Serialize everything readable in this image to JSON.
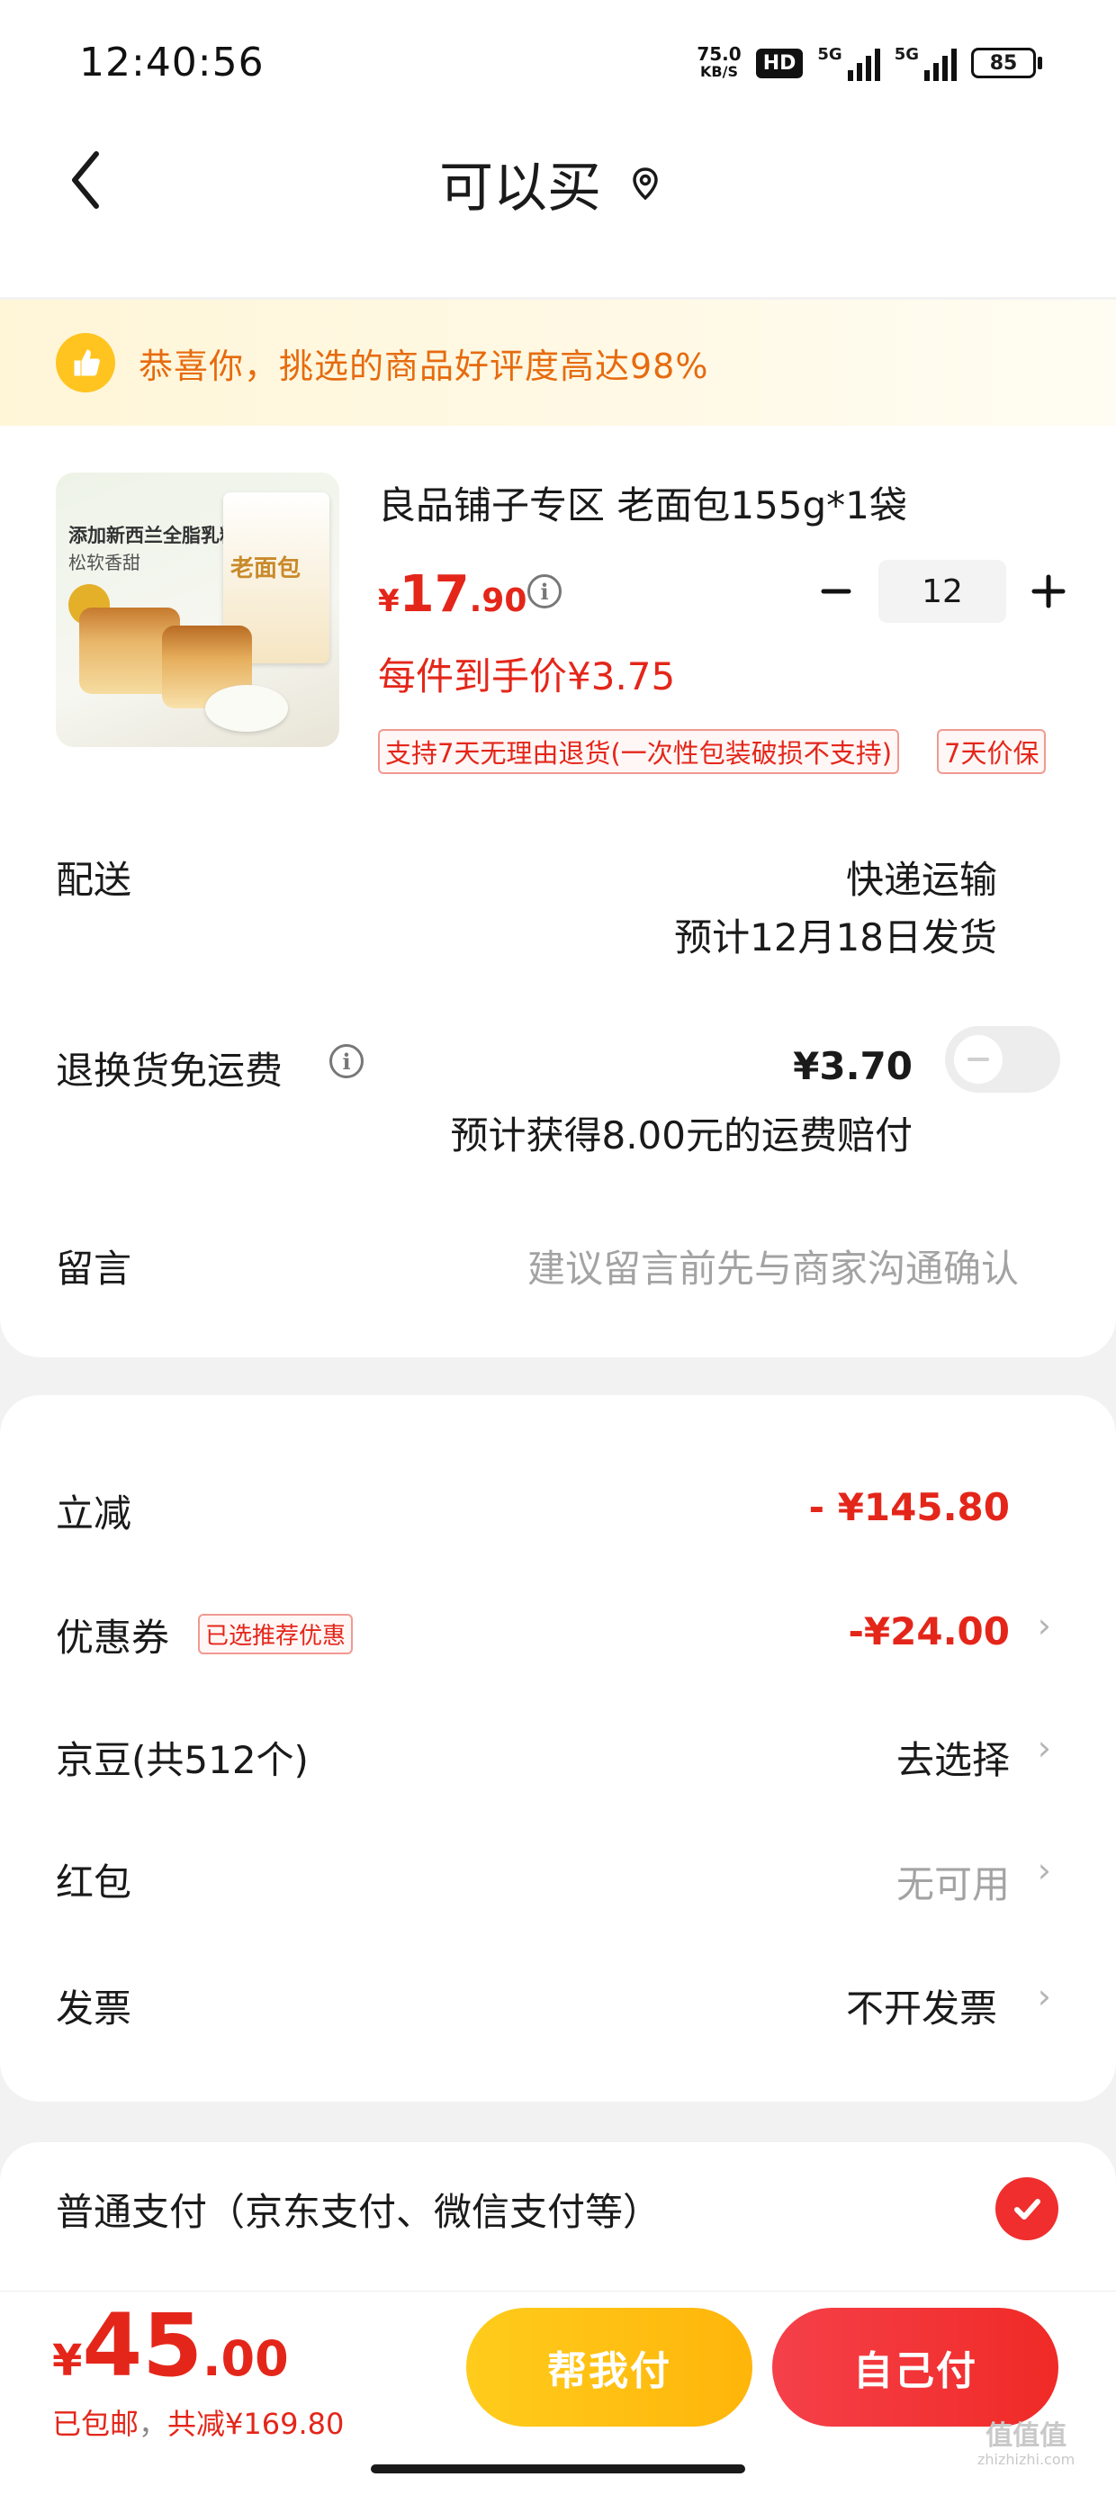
{
  "status_bar": {
    "time": "12:40:56",
    "net_speed_value": "75.0",
    "net_speed_unit": "KB/S",
    "hd_badge": "HD",
    "signal1_label": "5G",
    "signal2_label": "5G",
    "battery": "85"
  },
  "header": {
    "title": "可以买",
    "back_icon": "chevron-left-icon",
    "location_icon": "location-pin-icon"
  },
  "banner": {
    "icon": "thumbs-up-icon",
    "text": "恭喜你，挑选的商品好评度高达98%"
  },
  "product": {
    "name": "良品铺子专区 老面包155g*1袋",
    "image_text": "添加新西兰全脂乳粉",
    "image_subtext": "松软香甜",
    "image_pack_text": "老面包",
    "price_currency": "¥",
    "price_int": "17",
    "price_dec": ".90",
    "quantity": "12",
    "unit_price": "每件到手价¥3.75",
    "tags": [
      "支持7天无理由退货(一次性包装破损不支持)",
      "7天价保"
    ]
  },
  "delivery": {
    "label": "配送",
    "method": "快递运输",
    "eta": "预计12月18日发货"
  },
  "return_shipping": {
    "label": "退换货免运费",
    "price": "¥3.70",
    "compensation": "预计获得8.00元的运费赔付",
    "enabled": false
  },
  "message": {
    "label": "留言",
    "placeholder": "建议留言前先与商家沟通确认"
  },
  "discounts": {
    "instant_label": "立减",
    "instant_value": "- ¥145.80",
    "coupon_label": "优惠券",
    "coupon_badge": "已选推荐优惠",
    "coupon_value": "-¥24.00",
    "beans_label": "京豆(共512个)",
    "beans_value": "去选择",
    "redpack_label": "红包",
    "redpack_value": "无可用",
    "invoice_label": "发票",
    "invoice_value": "不开发票"
  },
  "payment": {
    "label": "普通支付（京东支付、微信支付等）",
    "selected": true
  },
  "bottom": {
    "total_currency": "¥",
    "total_int": "45",
    "total_dec": ".00",
    "shipping_note": "已包邮",
    "separator": "，",
    "saved_note": "共减¥169.80",
    "help_pay_label": "帮我付",
    "self_pay_label": "自己付"
  },
  "watermark": {
    "text": "值值值",
    "subtext": "zhizhizhi.com"
  },
  "colors": {
    "accent_red": "#e4261a",
    "banner_orange": "#e66b0f",
    "help_button_yellow": "#ffb50a",
    "self_button_red": "#f02a26"
  }
}
